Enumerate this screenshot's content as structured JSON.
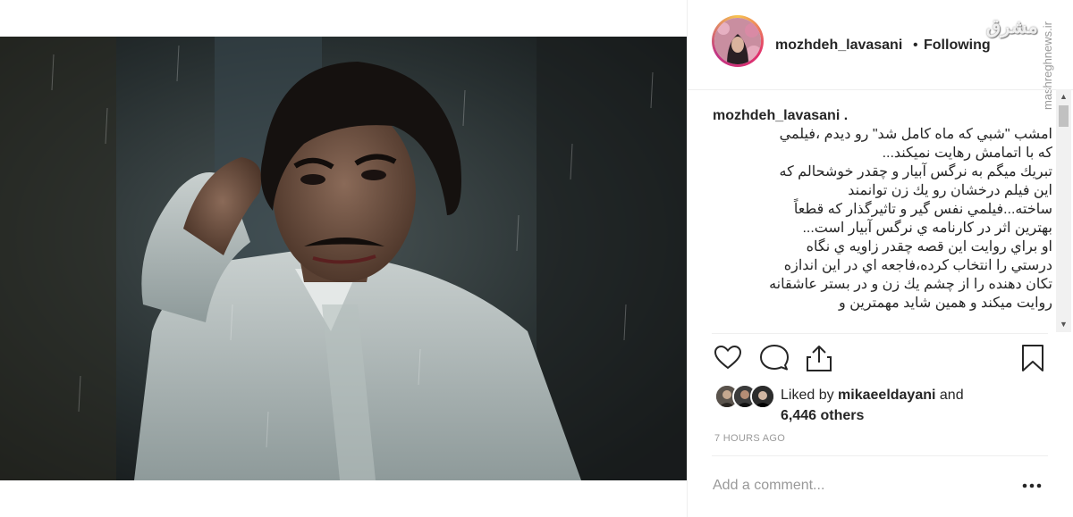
{
  "post": {
    "image_alt": "man in white shirt in the rain",
    "author": {
      "username": "mozhdeh_lavasani",
      "follow_separator": "•",
      "follow_state": "Following"
    },
    "watermark": {
      "logo_text": "مشرق",
      "site": "mashreghnews.ir"
    },
    "caption": {
      "username": "mozhdeh_lavasani",
      "lines": [
        "امشب \"شبي كه ماه كامل شد\" رو ديدم ،فيلمي",
        "كه با اتمامش رهايت نميكند...",
        "تبريك ميگم به نرگس آبيار و چقدر خوشحالم كه",
        "اين فيلم درخشان رو يك زن توانمند",
        "ساخته...فيلمي نفس گير و تاثيرگذار كه قطعاً",
        "بهترين اثر در كارنامه ي نرگس آبيار است...",
        "او براي روايت اين قصه چقدر زاويه ي نگاه",
        "درستي را انتخاب كرده،فاجعه اي در اين اندازه",
        "تكان دهنده را از چشم يك زن و در بستر عاشقانه",
        "روايت ميكند و همين شايد مهمترين و"
      ]
    },
    "actions": {
      "like": "heart-icon",
      "comment": "comment-icon",
      "share": "share-icon",
      "save": "bookmark-icon"
    },
    "likes": {
      "prefix": "Liked by ",
      "liker": "mikaeeldayani",
      "connector": " and",
      "others": "6,446 others"
    },
    "timestamp": "7 HOURS AGO",
    "comment": {
      "placeholder": "Add a comment...",
      "more_icon": "ellipsis-icon"
    }
  },
  "colors": {
    "text": "#262626",
    "muted": "#999999",
    "divider": "#efefef"
  }
}
